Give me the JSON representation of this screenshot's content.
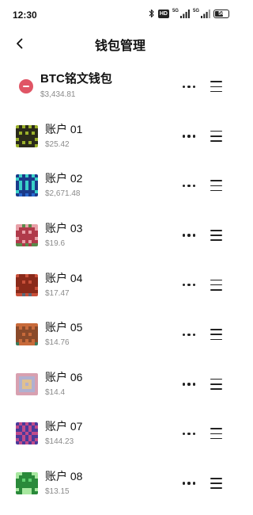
{
  "status_bar": {
    "time": "12:30",
    "network_label_1": "5G",
    "network_label_2": "5G",
    "battery": "56",
    "hd": "HD"
  },
  "header": {
    "title": "钱包管理",
    "back_icon": "chevron-left-icon"
  },
  "wallets": [
    {
      "name": "BTC铭文钱包",
      "balance": "$3,434.81",
      "icon": "remove-icon"
    },
    {
      "name": "账户 01",
      "balance": "$25.42",
      "icon": "pixel-avatar"
    },
    {
      "name": "账户 02",
      "balance": "$2,671.48",
      "icon": "pixel-avatar"
    },
    {
      "name": "账户 03",
      "balance": "$19.6",
      "icon": "pixel-avatar"
    },
    {
      "name": "账户 04",
      "balance": "$17.47",
      "icon": "pixel-avatar"
    },
    {
      "name": "账户 05",
      "balance": "$14.76",
      "icon": "pixel-avatar"
    },
    {
      "name": "账户 06",
      "balance": "$14.4",
      "icon": "pixel-avatar"
    },
    {
      "name": "账户 07",
      "balance": "$144.23",
      "icon": "pixel-avatar"
    },
    {
      "name": "账户 08",
      "balance": "$13.15",
      "icon": "pixel-avatar"
    }
  ],
  "colors": {
    "remove": "#e05565",
    "balance_text": "#8a8a8a",
    "avatar_01": [
      "#2a2a1a",
      "#d8e040",
      "#9ab02a"
    ],
    "avatar_02": [
      "#1a3a8a",
      "#3ad0c8",
      "#2a6ad0"
    ],
    "avatar_03": [
      "#b03a4a",
      "#e8a0a8",
      "#5a8a4a"
    ],
    "avatar_04": [
      "#8a2a1a",
      "#c8503a",
      "#5a6a7a"
    ],
    "avatar_05": [
      "#8a4a2a",
      "#c86a3a",
      "#3a7a5a"
    ],
    "avatar_06": [
      "#d8a0b0",
      "#b0b0d0",
      "#e0c090"
    ],
    "avatar_07": [
      "#4a3a9a",
      "#c04a8a",
      "#2a2a6a"
    ],
    "avatar_08": [
      "#2a8a3a",
      "#60d070",
      "#a8e8a0"
    ]
  }
}
